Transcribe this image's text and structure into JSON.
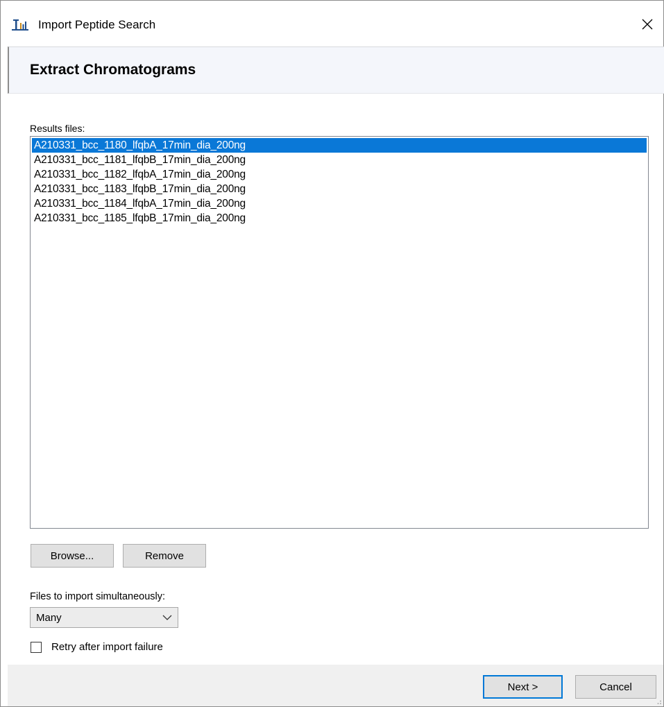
{
  "window": {
    "title": "Import Peptide Search",
    "icon": "skyline-app-icon",
    "close_icon": "close-icon"
  },
  "header": {
    "title": "Extract Chromatograms"
  },
  "results": {
    "label": "Results files:",
    "files": [
      "A210331_bcc_1180_lfqbA_17min_dia_200ng",
      "A210331_bcc_1181_lfqbB_17min_dia_200ng",
      "A210331_bcc_1182_lfqbA_17min_dia_200ng",
      "A210331_bcc_1183_lfqbB_17min_dia_200ng",
      "A210331_bcc_1184_lfqbA_17min_dia_200ng",
      "A210331_bcc_1185_lfqbB_17min_dia_200ng"
    ],
    "selected_index": 0
  },
  "buttons": {
    "browse": "Browse...",
    "remove": "Remove",
    "next": "Next >",
    "cancel": "Cancel"
  },
  "simultaneous": {
    "label": "Files to import simultaneously:",
    "value": "Many"
  },
  "retry": {
    "label": "Retry after import failure",
    "checked": false
  },
  "colors": {
    "selection": "#0a78d7",
    "default_button_border": "#0078d7",
    "header_bg": "#f4f6fb"
  }
}
